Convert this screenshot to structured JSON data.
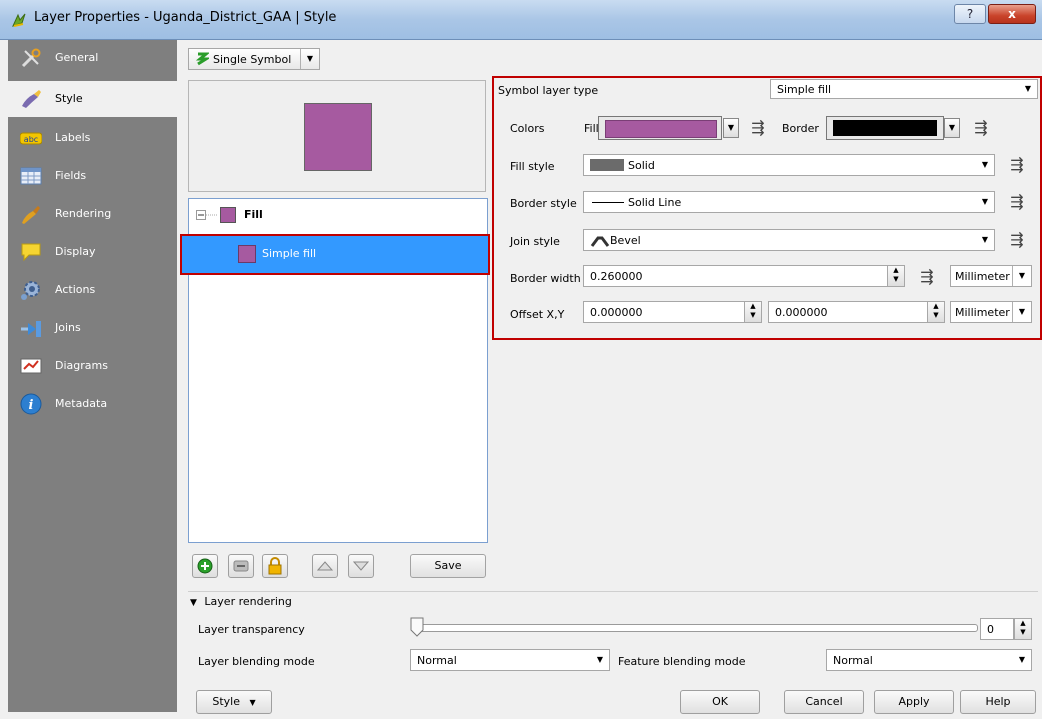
{
  "window": {
    "title": "Layer Properties - Uganda_District_GAA | Style",
    "help_label": "?",
    "close_label": "x"
  },
  "sidebar": {
    "items": [
      {
        "label": "General",
        "icon": "wrench-icon"
      },
      {
        "label": "Style",
        "icon": "paintbrush-icon",
        "selected": true
      },
      {
        "label": "Labels",
        "icon": "abc-label-icon"
      },
      {
        "label": "Fields",
        "icon": "table-icon"
      },
      {
        "label": "Rendering",
        "icon": "paint-icon"
      },
      {
        "label": "Display",
        "icon": "speech-bubble-icon"
      },
      {
        "label": "Actions",
        "icon": "gear-icon"
      },
      {
        "label": "Joins",
        "icon": "join-icon"
      },
      {
        "label": "Diagrams",
        "icon": "chart-icon"
      },
      {
        "label": "Metadata",
        "icon": "info-icon"
      }
    ]
  },
  "renderer": {
    "type_label": "Single Symbol"
  },
  "preview": {
    "fill_color": "#a65aa0"
  },
  "tree": {
    "root_label": "Fill",
    "child_label": "Simple fill"
  },
  "tree_buttons": {
    "save_label": "Save"
  },
  "symbol_layer": {
    "type_label": "Symbol layer type",
    "type_value": "Simple fill",
    "colors_label": "Colors",
    "fill_label": "Fill",
    "fill_color": "#a65aa0",
    "border_label": "Border",
    "border_color": "#000000",
    "fill_style_label": "Fill style",
    "fill_style_value": "Solid",
    "border_style_label": "Border style",
    "border_style_value": "Solid Line",
    "join_style_label": "Join style",
    "join_style_value": "Bevel",
    "border_width_label": "Border width",
    "border_width_value": "0.260000",
    "border_width_unit": "Millimeter",
    "offset_label": "Offset X,Y",
    "offset_x": "0.000000",
    "offset_y": "0.000000",
    "offset_unit": "Millimeter"
  },
  "layer_rendering": {
    "section_label": "Layer rendering",
    "transparency_label": "Layer transparency",
    "transparency_value": "0",
    "blending_label": "Layer blending mode",
    "blending_value": "Normal",
    "feature_blending_label": "Feature blending mode",
    "feature_blending_value": "Normal"
  },
  "footer": {
    "style_label": "Style",
    "ok_label": "OK",
    "cancel_label": "Cancel",
    "apply_label": "Apply",
    "help_label": "Help"
  }
}
